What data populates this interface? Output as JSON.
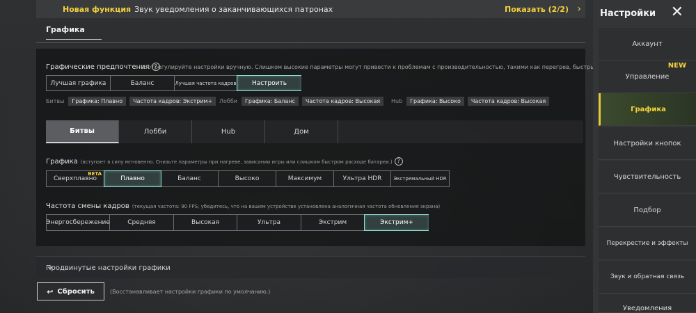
{
  "notification": {
    "highlight": "Новая функция",
    "text": "Звук уведомления о заканчивающихся патронах",
    "show_label": "Показать (2/2)",
    "show_icon": "chevron-right-icon",
    "speaker_icon": "speaker-icon"
  },
  "section": {
    "title": "Графика"
  },
  "preferences": {
    "title": "Графические предпочтения",
    "hint": "е: отрегулируйте настройки вручную. Слишком высокие параметры могут привести к проблемам с производительностью, такими как перегрев, быстрый разряд батареи",
    "options": [
      "Лучшая графика",
      "Баланс",
      "Лучшая частота кадров",
      "Настроить"
    ],
    "selected": "Настроить"
  },
  "summary": [
    {
      "label": "Битвы",
      "chips": [
        "Графика: Плавно",
        "Частота кадров: Экстрим+"
      ]
    },
    {
      "label": "Лобби",
      "chips": [
        "Графика: Баланс",
        "Частота кадров: Высокая"
      ]
    },
    {
      "label": "Hub",
      "chips": [
        "Графика: Высоко",
        "Частота кадров: Высокая"
      ]
    }
  ],
  "mode_tabs": [
    "Битвы",
    "Лобби",
    "Hub",
    "Дом"
  ],
  "active_mode": "Битвы",
  "graphics": {
    "title": "Графика",
    "hint": "(вступает в силу мгновенно. Снизьте параметры при нагреве, зависании игры или слишком быстром расходе батареи.)",
    "options": [
      "Сверхплавно",
      "Плавно",
      "Баланс",
      "Высоко",
      "Максимум",
      "Ультра HDR",
      "Экстремальный HDR"
    ],
    "beta_label": "BETA",
    "selected": "Плавно"
  },
  "framerate": {
    "title": "Частота смены кадров",
    "hint": "(текущая частота: 90 FPS; убедитесь, что на вашем устройстве установлена аналогичная частота обновления экрана)",
    "options": [
      "Энергосбережение",
      "Средняя",
      "Высокая",
      "Ультра",
      "Экстрим",
      "Экстрим+"
    ],
    "selected": "Экстрим+"
  },
  "advanced": {
    "label": "Продвинутые настройки графики"
  },
  "reset": {
    "label": "Сбросить",
    "note": "(Восстанавливает настройки графики по умолчанию.)"
  },
  "sidebar": {
    "title": "Настройки",
    "items": [
      "Аккаунт",
      "Управление",
      "Графика",
      "Настройки кнопок",
      "Чувствительность",
      "Подбор",
      "Перекрестие и эффекты",
      "Звук и обратная связь",
      "Уведомления"
    ],
    "new_badge": "NEW",
    "active": "Графика"
  },
  "colors": {
    "accent": "#f4d23c",
    "selected_border": "#8fe0d6",
    "panel": "#1d1e20"
  }
}
